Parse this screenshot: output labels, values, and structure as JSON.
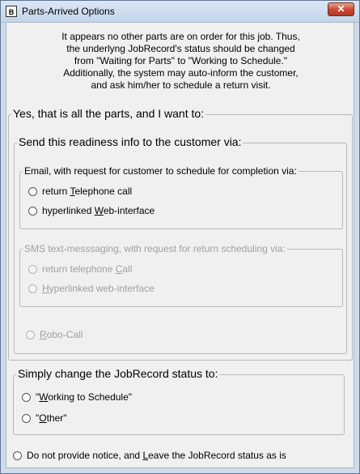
{
  "window": {
    "title": "Parts-Arrived Options",
    "close_label": "✕"
  },
  "message": "It appears no other parts are on order for this job.  Thus,\nthe underlyng JobRecord's status should be changed\nfrom \"Waiting for Parts\" to \"Working to Schedule.\"\nAdditionally, the system may auto-inform the customer,\nand ask him/her to schedule a return visit.",
  "group_yes": {
    "label": "Yes, that is all the parts, and I want to:"
  },
  "group_send": {
    "label": "Send this readiness info to the customer via:"
  },
  "group_email": {
    "label": "Email, with request for customer to schedule for completion via:",
    "options": [
      {
        "pre": "return ",
        "key": "T",
        "post": "elephone call"
      },
      {
        "pre": "hyperlinked ",
        "key": "W",
        "post": "eb-interface"
      }
    ]
  },
  "group_sms": {
    "label": "SMS text-messsaging, with request for return scheduling via:",
    "options": [
      {
        "pre": "return telephone ",
        "key": "C",
        "post": "all"
      },
      {
        "pre": "",
        "key": "H",
        "post": "yperlinked web-interface"
      }
    ]
  },
  "robocall": {
    "pre": "",
    "key": "R",
    "post": "obo-Call"
  },
  "group_status": {
    "label": "Simply change the JobRecord status to:",
    "options": [
      {
        "pre": "\"",
        "key": "W",
        "post": "orking to Schedule\""
      },
      {
        "pre": "\"",
        "key": "O",
        "post": "ther\""
      }
    ]
  },
  "no_notice": {
    "pre": "Do not provide notice, and ",
    "key": "L",
    "post": "eave the JobRecord status as is"
  },
  "colors": {
    "client_bg": "#f0f0f0",
    "close_red": "#c8452e",
    "disabled_text": "#a0a0a0"
  }
}
